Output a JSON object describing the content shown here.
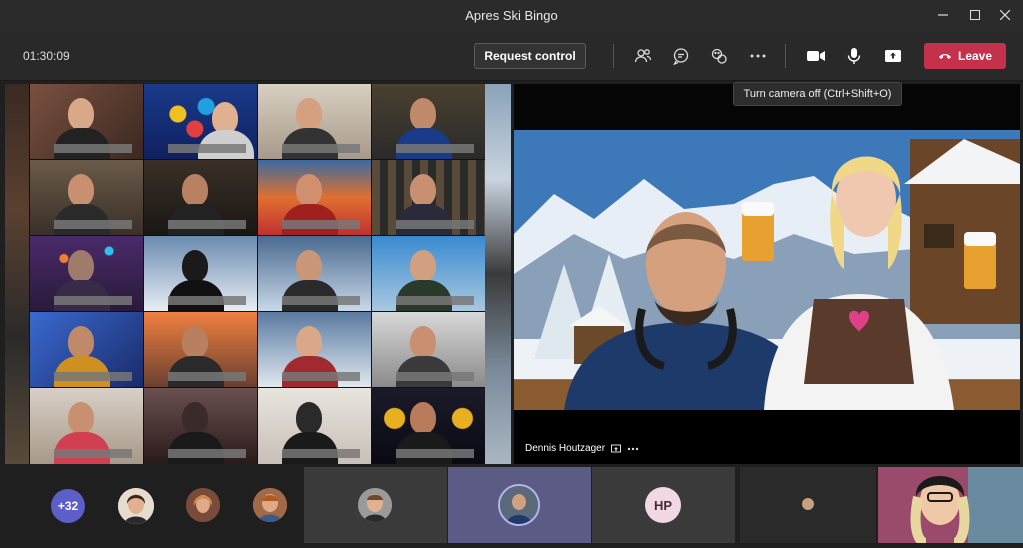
{
  "window": {
    "title": "Apres Ski Bingo",
    "controls": [
      "minimize-icon",
      "maximize-icon",
      "close-icon"
    ]
  },
  "toolbar": {
    "timer": "01:30:09",
    "request_control_label": "Request control",
    "leave_label": "Leave",
    "icons": [
      "people-icon",
      "chat-icon",
      "reactions-icon",
      "more-icon",
      "camera-icon",
      "microphone-icon",
      "share-icon"
    ]
  },
  "tooltip": {
    "text": "Turn camera off (Ctrl+Shift+O)"
  },
  "stage": {
    "presenter_name": "Dennis Houtzager"
  },
  "bottom": {
    "overflow_count": "+32",
    "initials_avatar": "HP"
  },
  "colors": {
    "leave": "#c4314b",
    "toolbar": "#292929",
    "titlebar": "#2b2b2b",
    "active_tile": "#5c5b86",
    "hp_avatar": "#f2d7e4"
  }
}
